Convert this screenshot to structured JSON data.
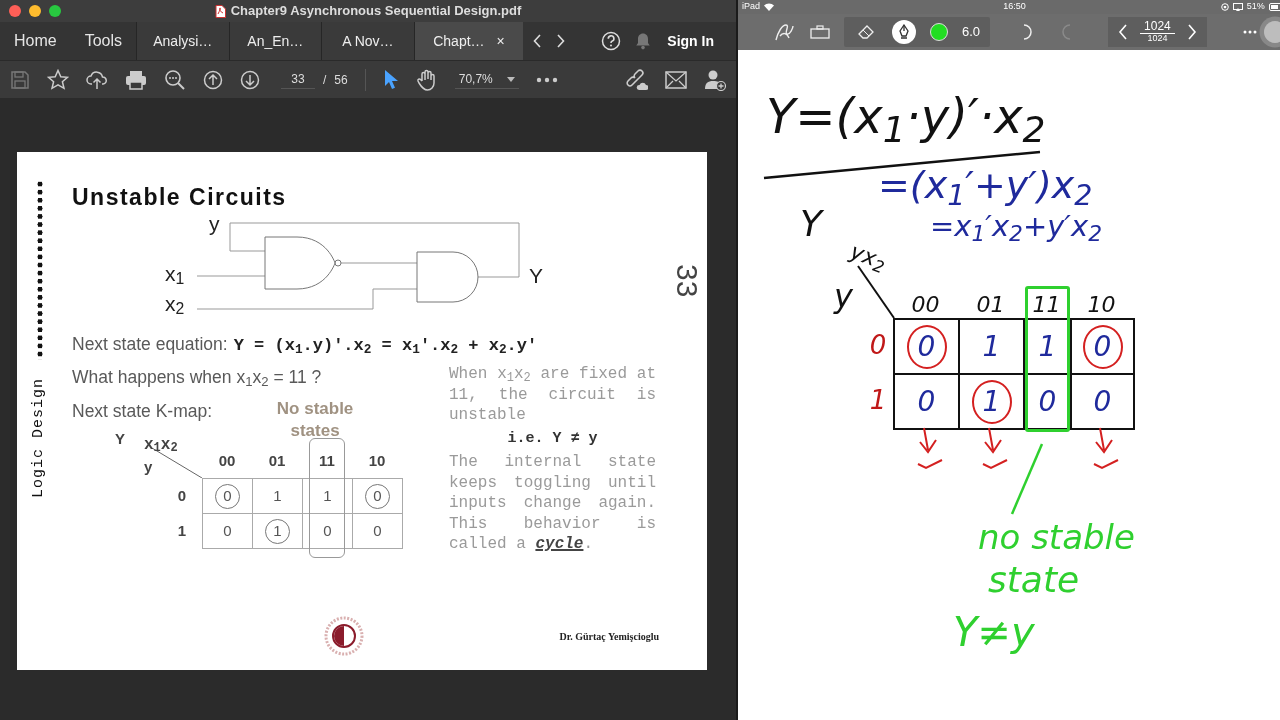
{
  "pdf_window": {
    "title": "Chapter9 Asynchronous Sequential Design.pdf",
    "nav": [
      {
        "label": "Home"
      },
      {
        "label": "Tools"
      }
    ],
    "tabs": [
      {
        "label": "Analysi…",
        "selected": false
      },
      {
        "label": "An_En…",
        "selected": false
      },
      {
        "label": "A Nov…",
        "selected": false
      },
      {
        "label": "Chapt…",
        "selected": true,
        "close": "×"
      }
    ],
    "sign_in": "Sign In",
    "toolbar": {
      "page": "33",
      "page_separator": "/",
      "page_total": "56",
      "zoom": "70,7%",
      "tools": [
        {
          "kind": "select",
          "selected": true
        },
        {
          "kind": "hand",
          "selected": false
        }
      ]
    },
    "slide": {
      "side_label": "Logic Design",
      "title": "Unstable Circuits",
      "circuit_labels": [
        "y",
        "x$_{1}$",
        "x$_{2}$",
        "Y"
      ],
      "equation_label": "Next state equation:",
      "equation": "Y = (x$_{1}$.y)′.x$_{2}$ = x$_{1}$′.x$_{2}$ + x$_{2}$.y′",
      "question": "What happens when x$_{1}$x$_{2}$ = 11 ?",
      "kmap_label": "Next state K-map:",
      "note": "No stable states",
      "kmap": {
        "output_label": "Y",
        "column_var": "x$_{1}$x$_{2}$",
        "row_var": "y",
        "columns": [
          {
            "label": "00",
            "highlighted": false
          },
          {
            "label": "01",
            "highlighted": false
          },
          {
            "label": "11",
            "highlighted": true
          },
          {
            "label": "10",
            "highlighted": false
          }
        ],
        "rows": [
          {
            "label": "0",
            "cells": [
              {
                "value": "0",
                "circled": true
              },
              {
                "value": "1",
                "circled": false
              },
              {
                "value": "1",
                "circled": false
              },
              {
                "value": "0",
                "circled": true
              }
            ]
          },
          {
            "label": "1",
            "cells": [
              {
                "value": "0",
                "circled": false
              },
              {
                "value": "1",
                "circled": true
              },
              {
                "value": "0",
                "circled": false
              },
              {
                "value": "0",
                "circled": false
              }
            ]
          }
        ]
      },
      "explanation": "When x$_{1}$x$_{2}$ are fixed at 11, the circuit is unstable",
      "conclusion": "i.e. Y ≠ y",
      "explanation_2": "The internal state keeps toggling until inputs change again. This behavior is called a **cycle**.",
      "page_number": "33",
      "author": "Dr. Gürtaç Yemişcioglu"
    }
  },
  "notes_app": {
    "status_bar": {
      "device": "iPad",
      "time": "16:50",
      "battery": "51%"
    },
    "toolbar": {
      "tools": [
        {
          "kind": "eraser",
          "selected": false
        },
        {
          "kind": "pen",
          "selected": true
        }
      ],
      "color": "#22dd22",
      "size": "6.0",
      "history": [
        {
          "kind": "undo",
          "disabled": false
        },
        {
          "kind": "redo",
          "disabled": true
        }
      ],
      "page_current": "1024",
      "page_total": "1024"
    },
    "ink": {
      "equations": [
        {
          "text": "Y=(x$_{1}$·y)′·x$_{2}$",
          "color": "#111111"
        },
        {
          "text": "=(x$_{1}$′+y′)x$_{2}$",
          "color": "#1f2a9c"
        },
        {
          "text": "=x$_{1}$′x$_{2}$+y′x$_{2}$",
          "color": "#1f2a9c"
        }
      ],
      "kmap": {
        "output_label": "Y",
        "corner_label": "yx$_{2}$",
        "row_var": "y",
        "columns": [
          {
            "label": "00",
            "boxed": false,
            "marked": true
          },
          {
            "label": "01",
            "boxed": false,
            "marked": true
          },
          {
            "label": "11",
            "boxed": true,
            "marked": false
          },
          {
            "label": "10",
            "boxed": false,
            "marked": true
          }
        ],
        "rows": [
          {
            "label": "0",
            "cells": [
              {
                "value": "0",
                "circled": true
              },
              {
                "value": "1",
                "circled": false
              },
              {
                "value": "1",
                "circled": false
              },
              {
                "value": "0",
                "circled": true
              }
            ]
          },
          {
            "label": "1",
            "cells": [
              {
                "value": "0",
                "circled": false
              },
              {
                "value": "1",
                "circled": true
              },
              {
                "value": "0",
                "circled": false
              },
              {
                "value": "0",
                "circled": false
              }
            ]
          }
        ]
      },
      "notes": [
        {
          "text": "no stable"
        },
        {
          "text": "state"
        },
        {
          "text": "Y≠y"
        }
      ]
    }
  }
}
